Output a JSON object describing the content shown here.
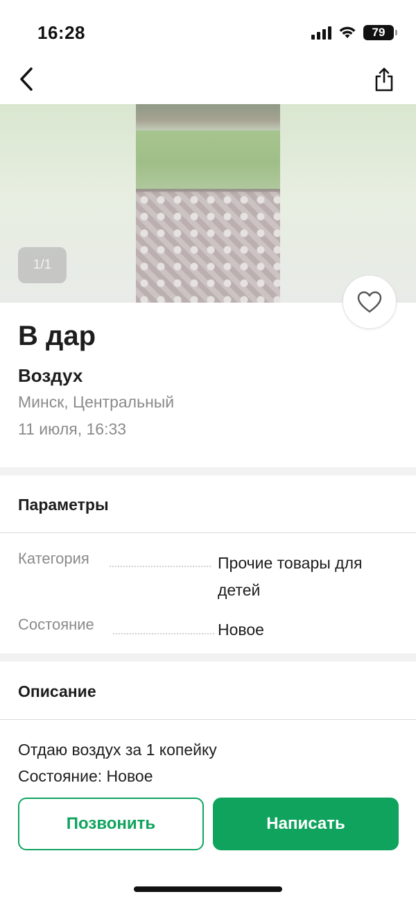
{
  "status_bar": {
    "time": "16:28",
    "battery": "79",
    "icons": [
      "signal-icon",
      "wifi-icon",
      "battery-icon"
    ]
  },
  "nav": {
    "back_icon": "chevron-left-icon",
    "share_icon": "share-icon"
  },
  "gallery": {
    "counter": "1/1"
  },
  "favorite_icon": "heart-outline-icon",
  "listing": {
    "title": "В дар",
    "subtitle": "Воздух",
    "location": "Минск, Центральный",
    "date": "11 июля, 16:33"
  },
  "parameters": {
    "heading": "Параметры",
    "items": [
      {
        "label": "Категория",
        "value_line1": "Прочие товары для",
        "value_line2": "детей"
      },
      {
        "label": "Состояние",
        "value_line1": "Новое"
      }
    ]
  },
  "description": {
    "heading": "Описание",
    "lines": [
      "Отдаю воздух за 1 копейку",
      "Состояние: Новое"
    ]
  },
  "actions": {
    "call_label": "Позвонить",
    "write_label": "Написать"
  },
  "colors": {
    "accent": "#0fa35e",
    "muted_text": "#8a8a8a",
    "text": "#1d1d1d"
  }
}
